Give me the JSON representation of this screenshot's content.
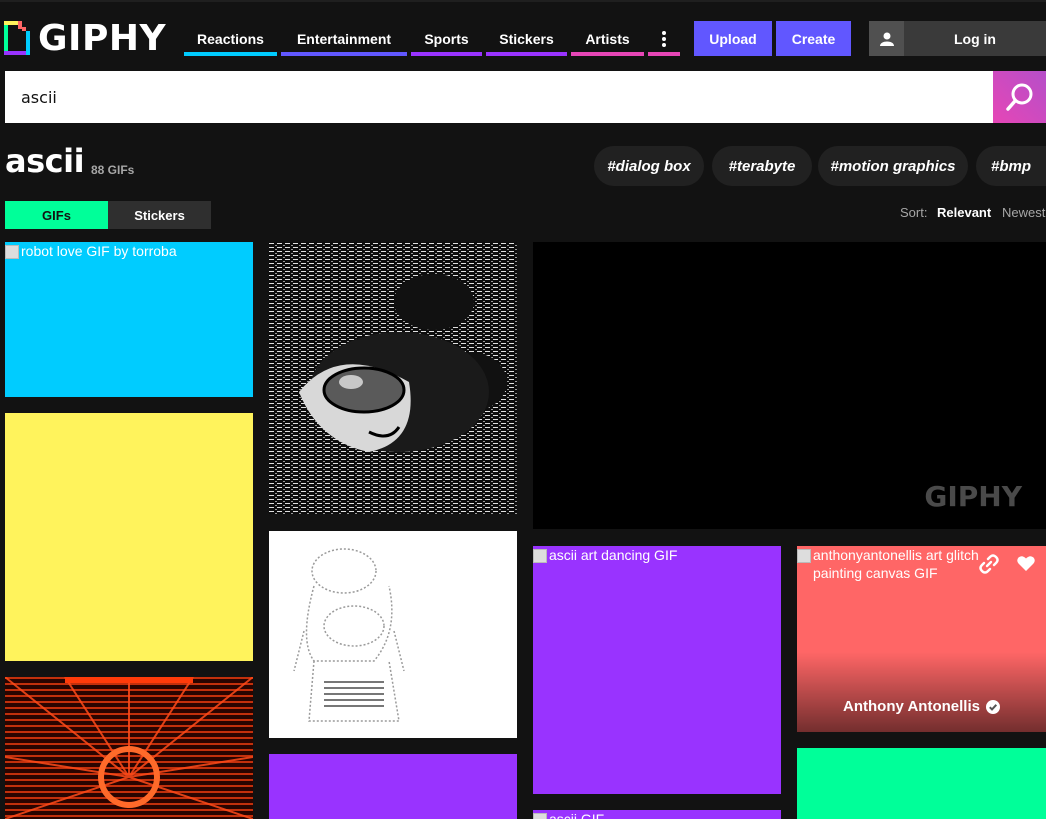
{
  "brand": {
    "name": "GIPHY"
  },
  "nav": {
    "items": [
      {
        "label": "Reactions",
        "color": "#00ccff"
      },
      {
        "label": "Entertainment",
        "color": "#6157ff"
      },
      {
        "label": "Sports",
        "color": "#9933ff"
      },
      {
        "label": "Stickers",
        "color": "#9933ff"
      },
      {
        "label": "Artists",
        "color": "#e646b6"
      }
    ],
    "more_icon": "vertical-ellipsis-icon",
    "upload_label": "Upload",
    "create_label": "Create",
    "login_label": "Log in"
  },
  "search": {
    "value": "ascii",
    "icon": "search-icon",
    "accent": "#e646b6"
  },
  "results": {
    "title": "ascii",
    "count": "88 GIFs",
    "tags": [
      "#dialog box",
      "#terabyte",
      "#motion graphics",
      "#bmp"
    ]
  },
  "tabs": {
    "gifs": "GIFs",
    "stickers": "Stickers",
    "active_color": "#00ff99"
  },
  "sort": {
    "label": "Sort:",
    "relevant": "Relevant",
    "newest": "Newest"
  },
  "grid": {
    "tile1_alt": "robot love GIF by torroba",
    "tile_watermark": "GIPHY",
    "tile_dancing_alt": "ascii art dancing GIF",
    "tile_glitch_alt": "anthonyantonellis art glitch painting canvas GIF",
    "tile_glitch_user": "Anthony Antonellis",
    "tile_ascii_alt": "ascii GIF",
    "colors": {
      "cyan": "#00ccff",
      "yellow": "#fff35c",
      "purple": "#9933ff",
      "coral": "#ff6666",
      "green": "#00ff99"
    }
  }
}
